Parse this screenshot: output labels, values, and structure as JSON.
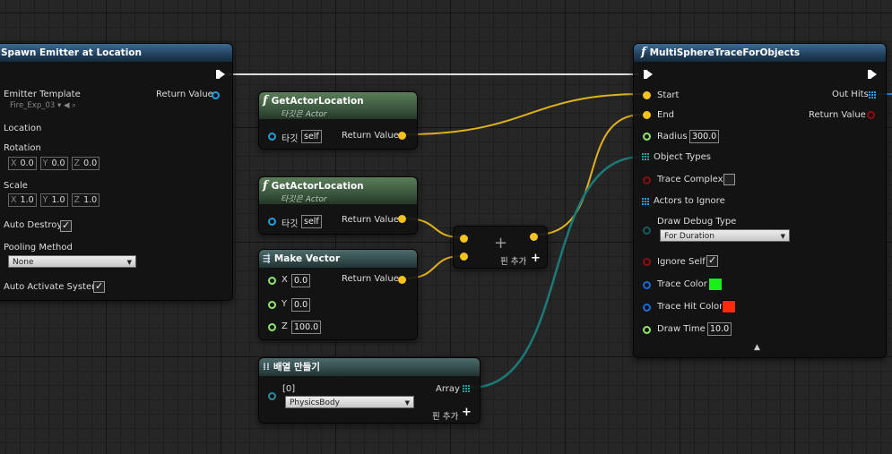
{
  "colors": {
    "exec": "#ffffff",
    "vector": "#f4c21f",
    "object": "#1ea0e0",
    "float": "#8fe86a",
    "bool": "#8b0d0d",
    "struct": "#2c8aa0",
    "color_on": "#18f018",
    "color_hit": "#ff2a0a"
  },
  "spawn": {
    "title": "Spawn Emitter at Location",
    "emitter_template": "Emitter Template",
    "emitter_value": "Fire_Exp_03",
    "return_value": "Return Value",
    "location": "Location",
    "rotation": "Rotation",
    "rot": {
      "x": "0.0",
      "y": "0.0",
      "z": "0.0"
    },
    "scale": "Scale",
    "scl": {
      "x": "1.0",
      "y": "1.0",
      "z": "1.0"
    },
    "auto_destroy": "Auto Destroy",
    "pooling_method": "Pooling Method",
    "pooling_value": "None",
    "auto_activate": "Auto Activate System",
    "x": "X",
    "y": "Y",
    "z": "Z"
  },
  "get1": {
    "title": "GetActorLocation",
    "subtitle": "타깃은 Actor",
    "target": "타깃",
    "self": "self",
    "return_value": "Return Value"
  },
  "get2": {
    "title": "GetActorLocation",
    "subtitle": "타깃은 Actor",
    "target": "타깃",
    "self": "self",
    "return_value": "Return Value"
  },
  "make_vector": {
    "title": "Make Vector",
    "x": "X",
    "y": "Y",
    "z": "Z",
    "xv": "0.0",
    "yv": "0.0",
    "zv": "100.0",
    "return_value": "Return Value"
  },
  "add": {
    "plus": "+",
    "add_pin": "핀 추가"
  },
  "array": {
    "title": "배열 만들기",
    "index": "[0]",
    "value": "PhysicsBody",
    "out": "Array",
    "add_pin": "핀 추가"
  },
  "trace": {
    "title": "MultiSphereTraceForObjects",
    "start": "Start",
    "end": "End",
    "radius": "Radius",
    "radius_value": "300.0",
    "object_types": "Object Types",
    "trace_complex": "Trace Complex",
    "actors_to_ignore": "Actors to Ignore",
    "draw_debug_type": "Draw Debug Type",
    "draw_debug_value": "For Duration",
    "ignore_self": "Ignore Self",
    "trace_color": "Trace Color",
    "trace_hit_color": "Trace Hit Color",
    "draw_time": "Draw Time",
    "draw_time_value": "10.0",
    "out_hits": "Out Hits",
    "return_value": "Return Value"
  }
}
